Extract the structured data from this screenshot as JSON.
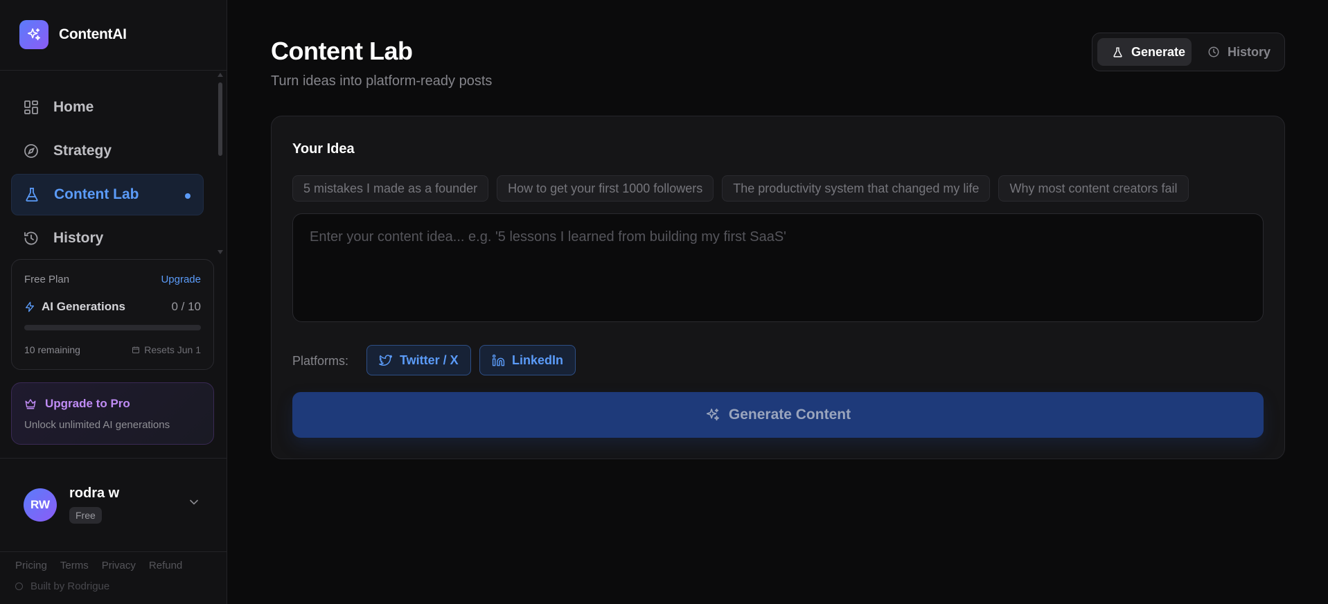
{
  "brand": {
    "name": "ContentAI",
    "icon": "sparkle-icon",
    "gradient": [
      "#5b7cfa",
      "#8b5cf6"
    ]
  },
  "nav": {
    "items": [
      {
        "label": "Home",
        "icon": "grid-icon"
      },
      {
        "label": "Strategy",
        "icon": "compass-icon"
      },
      {
        "label": "Content Lab",
        "icon": "flask-icon",
        "active": true
      },
      {
        "label": "History",
        "icon": "history-icon"
      }
    ]
  },
  "plan": {
    "label": "Free Plan",
    "upgrade": "Upgrade",
    "generations_label": "AI Generations",
    "generations_count": "0 / 10",
    "usage_fraction": 0,
    "remaining": "10 remaining",
    "resets": "Resets Jun 1"
  },
  "pro": {
    "title": "Upgrade to Pro",
    "subtitle": "Unlock unlimited AI generations"
  },
  "user": {
    "initials": "RW",
    "name": "rodra w",
    "badge": "Free"
  },
  "footer": {
    "links": [
      "Pricing",
      "Terms",
      "Privacy",
      "Refund"
    ],
    "built_by": "Built by Rodrigue"
  },
  "header": {
    "title": "Content Lab",
    "subtitle": "Turn ideas into platform-ready posts",
    "tabs": [
      {
        "label": "Generate",
        "icon": "flask-icon",
        "active": true
      },
      {
        "label": "History",
        "icon": "clock-icon",
        "active": false
      }
    ]
  },
  "idea": {
    "title": "Your Idea",
    "suggestions": [
      "5 mistakes I made as a founder",
      "How to get your first 1000 followers",
      "The productivity system that changed my life",
      "Why most content creators fail"
    ],
    "value": "",
    "placeholder": "Enter your content idea... e.g. '5 lessons I learned from building my first SaaS'"
  },
  "platforms": {
    "label": "Platforms:",
    "options": [
      {
        "label": "Twitter / X",
        "icon": "twitter-icon"
      },
      {
        "label": "LinkedIn",
        "icon": "linkedin-icon"
      }
    ]
  },
  "generate_button": {
    "label": "Generate Content",
    "icon": "sparkle-icon"
  },
  "colors": {
    "accent": "#5b9bf8",
    "pro": "#c08cf5",
    "primary_button": "#1e3a7a",
    "background": "#0b0b0c"
  }
}
